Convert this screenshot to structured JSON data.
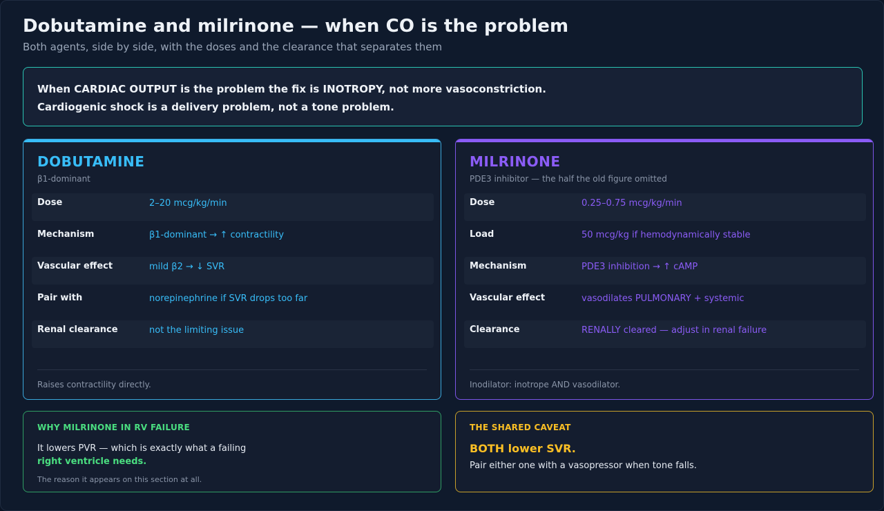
{
  "header": {
    "title": "Dobutamine and milrinone — when CO is the problem",
    "subtitle": "Both agents, side by side, with the doses and the clearance that separates them"
  },
  "callout": {
    "line1": "When CARDIAC OUTPUT is the problem the fix is INOTROPY, not more vasoconstriction.",
    "line2": "Cardiogenic shock is a delivery problem, not a tone problem."
  },
  "dobutamine": {
    "name": "DOBUTAMINE",
    "tag": "β1-dominant",
    "rows": [
      {
        "key": "Dose",
        "value": "2–20 mcg/kg/min"
      },
      {
        "key": "Mechanism",
        "value": "β1-dominant → ↑ contractility"
      },
      {
        "key": "Vascular effect",
        "value": "mild β2 → ↓ SVR"
      },
      {
        "key": "Pair with",
        "value": "norepinephrine if SVR drops too far"
      },
      {
        "key": "Renal clearance",
        "value": "not the limiting issue"
      }
    ],
    "footer": "Raises contractility directly."
  },
  "milrinone": {
    "name": "MILRINONE",
    "tag": "PDE3 inhibitor — the half the old figure omitted",
    "rows": [
      {
        "key": "Dose",
        "value": "0.25–0.75 mcg/kg/min"
      },
      {
        "key": "Load",
        "value": "50 mcg/kg if hemodynamically stable"
      },
      {
        "key": "Mechanism",
        "value": "PDE3 inhibition → ↑ cAMP"
      },
      {
        "key": "Vascular effect",
        "value": "vasodilates PULMONARY + systemic"
      },
      {
        "key": "Clearance",
        "value": "RENALLY cleared — adjust in renal failure"
      }
    ],
    "footer": "Inodilator: inotrope AND vasodilator."
  },
  "rv_box": {
    "label": "WHY MILRINONE IN RV FAILURE",
    "body": "It lowers PVR — which is exactly what a failing",
    "emphasis": "right ventricle needs.",
    "note": "The reason it appears on this section at all."
  },
  "caveat_box": {
    "label": "THE SHARED CAVEAT",
    "headline": "BOTH lower SVR.",
    "body": "Pair either one with a vasopressor when tone falls."
  },
  "colors": {
    "dobutamine_accent": "#38bdf8",
    "milrinone_accent": "#8b5cf6",
    "rv_accent": "#4ade80",
    "caveat_accent": "#fbbf24",
    "callout_border": "#2ac4b2"
  }
}
